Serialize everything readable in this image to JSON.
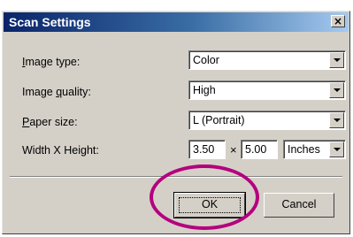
{
  "window": {
    "title": "Scan Settings",
    "close_icon": "close-icon",
    "close_symbol": "×"
  },
  "rows": {
    "image_type": {
      "label_first": "I",
      "label_rest": "mage type:",
      "value": "Color"
    },
    "image_quality": {
      "label_pre": "Image ",
      "label_under": "q",
      "label_post": "uality:",
      "value": "High"
    },
    "paper_size": {
      "label_first": "P",
      "label_rest": "aper size:",
      "value": "L (Portrait)"
    },
    "width_height": {
      "label": "Width X Height:",
      "width": "3.50",
      "times": "×",
      "height": "5.00",
      "unit": "Inches"
    }
  },
  "buttons": {
    "ok": "OK",
    "cancel": "Cancel"
  },
  "colors": {
    "highlight_ring": "#b5007e",
    "titlebar": "#0a246a"
  }
}
